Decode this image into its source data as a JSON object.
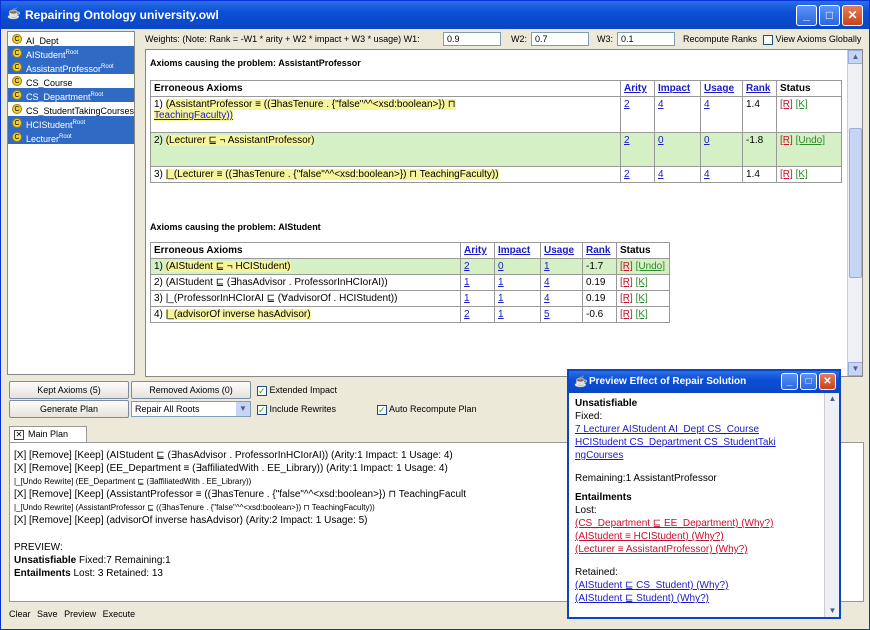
{
  "window": {
    "title": "Repairing Ontology university.owl"
  },
  "tree": {
    "items": [
      {
        "label": "AI_Dept",
        "sup": ""
      },
      {
        "label": "AIStudent",
        "sup": "Root"
      },
      {
        "label": "AssistantProfessor",
        "sup": "Root"
      },
      {
        "label": "CS_Course",
        "sup": ""
      },
      {
        "label": "CS_Department",
        "sup": "Root"
      },
      {
        "label": "CS_StudentTakingCourses",
        "sup": ""
      },
      {
        "label": "HCIStudent",
        "sup": "Root"
      },
      {
        "label": "Lecturer",
        "sup": "Root"
      }
    ]
  },
  "weights": {
    "label": "Weights: (Note: Rank = -W1 * arity + W2 * impact + W3 * usage) W1:",
    "w1": "0.9",
    "w2_label": "W2:",
    "w2": "0.7",
    "w3_label": "W3:",
    "w3": "0.1",
    "recompute": "Recompute Ranks",
    "view_globally": "View Axioms Globally"
  },
  "section1": {
    "title": "Axioms causing the problem: AssistantProfessor",
    "headers": [
      "Erroneous Axioms",
      "Arity",
      "Impact",
      "Usage",
      "Rank",
      "Status"
    ],
    "rows": [
      {
        "num": "1)",
        "axiom_a": "(AssistantProfessor ≡ ((∃hasTenure . {\"false\"^^<xsd:boolean>}) ⊓",
        "axiom_b": "TeachingFaculty))",
        "arity": "2",
        "impact": "4",
        "usage": "4",
        "rank": "1.4",
        "status_r": "[R]",
        "status_k": "[K]"
      },
      {
        "num": "2)",
        "axiom_a": "(Lecturer ⊑ ¬ AssistantProfessor)",
        "axiom_b": "",
        "arity": "2",
        "impact": "0",
        "usage": "0",
        "rank": "-1.8",
        "status_r": "[R]",
        "status_k": "[Undo]"
      },
      {
        "num": "3)",
        "axiom_a": "|_(Lecturer ≡ ((∃hasTenure . {\"false\"^^<xsd:boolean>}) ⊓ TeachingFaculty))",
        "axiom_b": "",
        "arity": "2",
        "impact": "4",
        "usage": "4",
        "rank": "1.4",
        "status_r": "[R]",
        "status_k": "[K]"
      }
    ]
  },
  "section2": {
    "title": "Axioms causing the problem: AIStudent",
    "headers": [
      "Erroneous Axioms",
      "Arity",
      "Impact",
      "Usage",
      "Rank",
      "Status"
    ],
    "rows": [
      {
        "num": "1)",
        "axiom": "(AIStudent ⊑ ¬ HCIStudent)",
        "arity": "2",
        "impact": "0",
        "usage": "1",
        "rank": "-1.7",
        "status_r": "[R]",
        "status_k": "[Undo]"
      },
      {
        "num": "2)",
        "axiom": "(AIStudent ⊑ (∃hasAdvisor . ProfessorInHCIorAI))",
        "arity": "1",
        "impact": "1",
        "usage": "4",
        "rank": "0.19",
        "status_r": "[R]",
        "status_k": "[K]"
      },
      {
        "num": "3)",
        "axiom": "|_(ProfessorInHCIorAI ⊑ (∀advisorOf . HCIStudent))",
        "arity": "1",
        "impact": "1",
        "usage": "4",
        "rank": "0.19",
        "status_r": "[R]",
        "status_k": "[K]"
      },
      {
        "num": "4)",
        "axiom": "|_(advisorOf inverse hasAdvisor)",
        "arity": "2",
        "impact": "1",
        "usage": "5",
        "rank": "-0.6",
        "status_r": "[R]",
        "status_k": "[K]"
      }
    ]
  },
  "controls": {
    "kept": "Kept Axioms (5)",
    "removed": "Removed Axioms (0)",
    "extended": "Extended Impact",
    "generate": "Generate Plan",
    "repair_select": "Repair All Roots",
    "include_rewrites": "Include Rewrites",
    "auto_recompute": "Auto Recompute Plan"
  },
  "plan": {
    "tab": "Main Plan",
    "line1": "[X] [Remove] [Keep] (AIStudent ⊑ (∃hasAdvisor . ProfessorInHCIorAI))  (Arity:1  Impact: 1  Usage: 4)",
    "line2": "[X] [Remove] [Keep] (EE_Department ≡ (∃affiliatedWith . EE_Library))  (Arity:1  Impact: 1  Usage: 4)",
    "line3": "|_[Undo Rewrite] (EE_Department ⊑ (∃affiliatedWith . EE_Library))",
    "line4": "[X] [Remove] [Keep] (AssistantProfessor ≡ ((∃hasTenure . {\"false\"^^<xsd:boolean>}) ⊓ TeachingFacult",
    "line5": "|_[Undo Rewrite] (AssistantProfessor ⊑ ((∃hasTenure . {\"false\"^^<xsd:boolean>}) ⊓ TeachingFaculty))",
    "line6": "[X] [Remove] [Keep] (advisorOf inverse hasAdvisor)  (Arity:2  Impact: 1  Usage: 5)",
    "preview": "PREVIEW:",
    "unsat_label": "Unsatisfiable",
    "unsat_text": "Fixed:7 Remaining:1",
    "ent_label": "Entailments",
    "ent_text": "Lost: 3 Retained: 13"
  },
  "footer": {
    "clear": "Clear",
    "save": "Save",
    "preview": "Preview",
    "execute": "Execute"
  },
  "popup": {
    "title": "Preview Effect of Repair Solution",
    "unsat": "Unsatisfiable",
    "fixed_label": "Fixed:",
    "fixed_line1": "7 Lecturer AIStudent AI_Dept CS_Course",
    "fixed_line2": "HCIStudent CS_Department CS_StudentTaki",
    "fixed_line3": "ngCourses",
    "remaining": "Remaining:1 AssistantProfessor",
    "entailments": "Entailments",
    "lost_label": "Lost:",
    "lost1": "(CS_Department ⊑ EE_Department) (Why?)",
    "lost2": "(AIStudent ≡ HCIStudent) (Why?)",
    "lost3": "(Lecturer ≡ AssistantProfessor) (Why?)",
    "retained_label": "Retained:",
    "ret1": "(AIStudent ⊑ CS_Student) (Why?)",
    "ret2": "(AIStudent ⊑ Student) (Why?)"
  }
}
